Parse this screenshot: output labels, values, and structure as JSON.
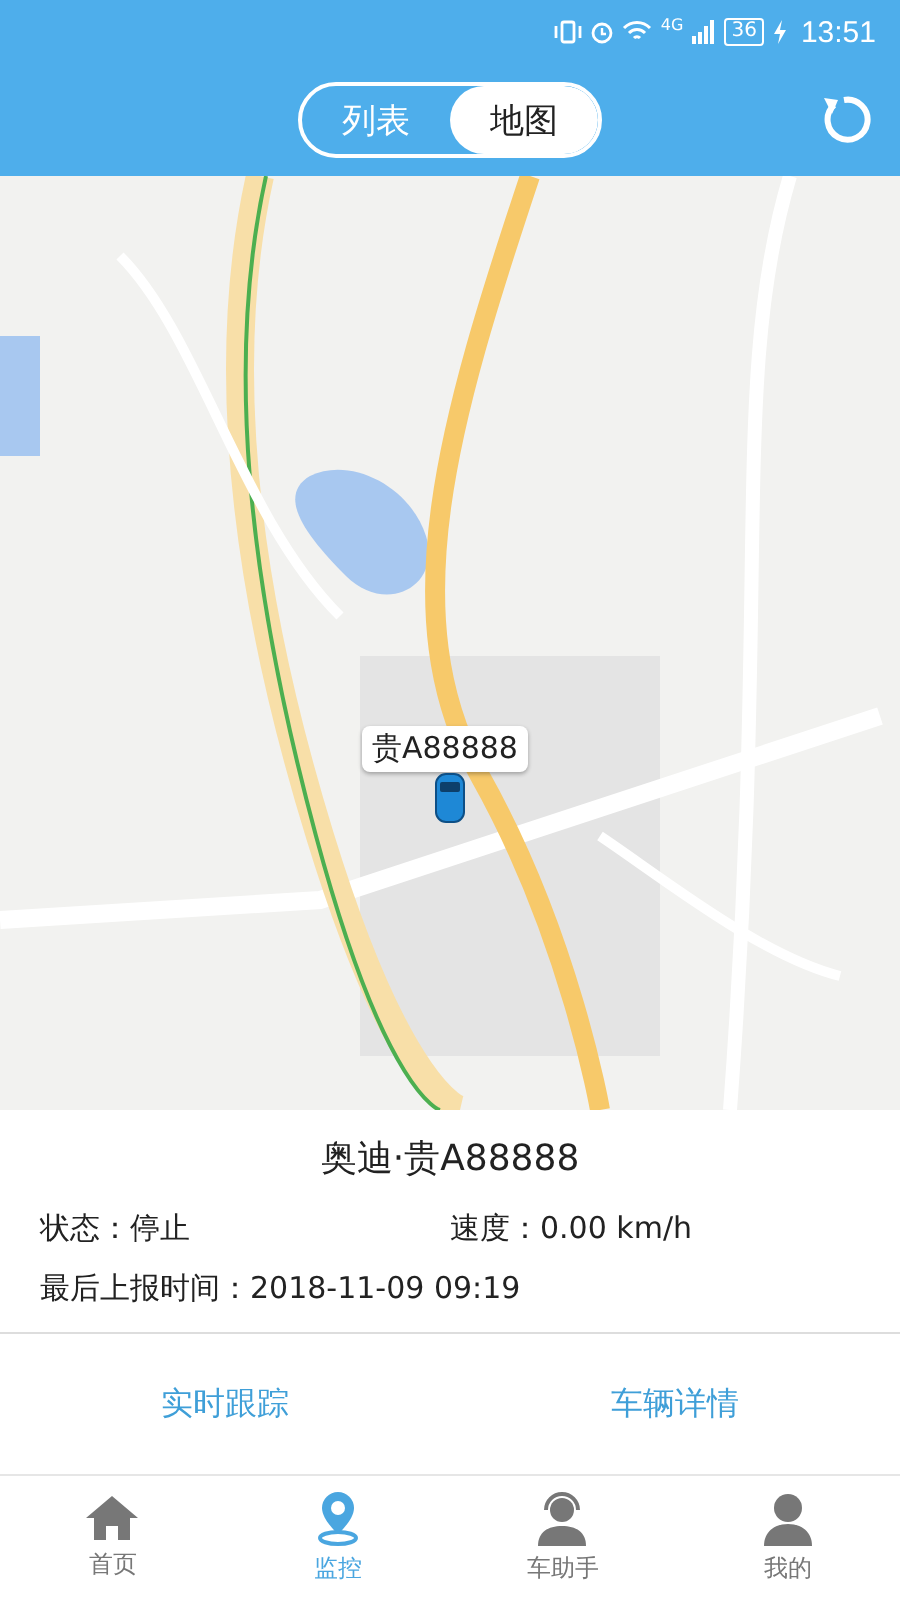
{
  "status_bar": {
    "network": "4G",
    "battery": "36",
    "time": "13:51"
  },
  "tabs": [
    {
      "label": "列表",
      "selected": false
    },
    {
      "label": "地图",
      "selected": true
    }
  ],
  "map": {
    "kind": "picture",
    "marker": {
      "label": "贵A88888"
    }
  },
  "vehicle": {
    "title": "奥迪·贵A88888",
    "status": "状态：停止",
    "speed": "速度：0.00 km/h",
    "last_report": "最后上报时间：2018-11-09 09:19"
  },
  "actions": [
    "实时跟踪",
    "车辆详情"
  ],
  "nav": [
    {
      "label": "首页",
      "kind": "home",
      "selected": false
    },
    {
      "label": "监控",
      "kind": "pin",
      "selected": true
    },
    {
      "label": "车助手",
      "kind": "headset",
      "selected": false
    },
    {
      "label": "我的",
      "kind": "person",
      "selected": false
    }
  ]
}
